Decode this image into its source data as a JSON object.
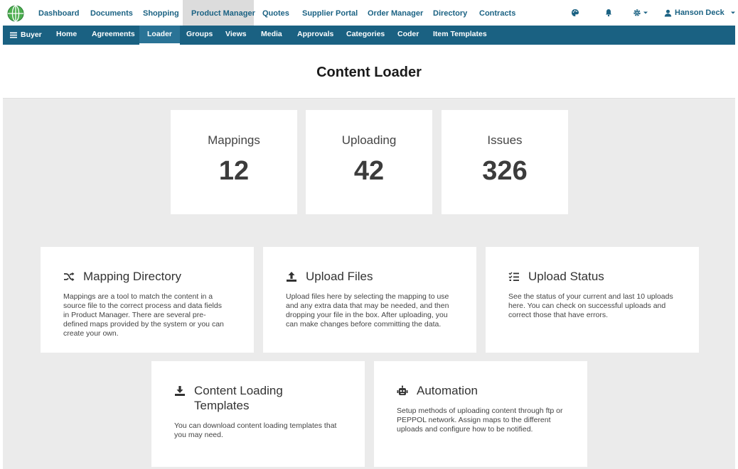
{
  "topnav": {
    "items": [
      "Dashboard",
      "Documents",
      "Shopping",
      "Product Manager",
      "Quotes",
      "Supplier Portal",
      "Order Manager",
      "Directory",
      "Contracts"
    ],
    "active": "Product Manager",
    "user_name": "Hanson Deck"
  },
  "subnav": {
    "menu_label": "Buyer",
    "items": [
      "Home",
      "Agreements",
      "Loader",
      "Groups",
      "Views",
      "Media",
      "Approvals",
      "Categories",
      "Coder",
      "Item Templates"
    ],
    "active": "Loader"
  },
  "page": {
    "title": "Content Loader"
  },
  "stats": [
    {
      "label": "Mappings",
      "value": "12"
    },
    {
      "label": "Uploading",
      "value": "42"
    },
    {
      "label": "Issues",
      "value": "326"
    }
  ],
  "cards": [
    {
      "icon": "shuffle-icon",
      "title": "Mapping Directory",
      "description": "Mappings are a tool to match the content in a source file to the correct process and data fields in Product Manager. There are several pre-defined maps provided by the system or you can create your own."
    },
    {
      "icon": "upload-icon",
      "title": "Upload Files",
      "description": "Upload files here by selecting the mapping to use and any extra data that may be needed, and then dropping your file in the box. After uploading, you can make changes before committing the data."
    },
    {
      "icon": "task-list-icon",
      "title": "Upload Status",
      "description": "See the status of your current and last 10 uploads here. You can check on successful uploads and correct those that have errors."
    },
    {
      "icon": "download-icon",
      "title": "Content Loading Templates",
      "description": "You can download content loading templates that you may need."
    },
    {
      "icon": "robot-icon",
      "title": "Automation",
      "description": "Setup methods of uploading content through ftp or PEPPOL network. Assign maps to the different uploads and configure how to be notified."
    }
  ],
  "colors": {
    "brand": "#1a6182",
    "link": "#1b6283",
    "background": "#ebebeb"
  }
}
